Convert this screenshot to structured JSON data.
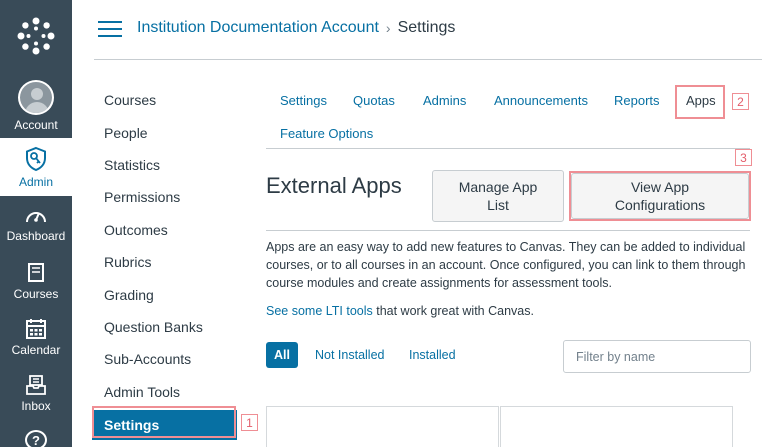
{
  "global_nav": {
    "account": "Account",
    "admin": "Admin",
    "dashboard": "Dashboard",
    "courses": "Courses",
    "calendar": "Calendar",
    "inbox": "Inbox",
    "help_glyph": "?"
  },
  "breadcrumb": {
    "account": "Institution Documentation Account",
    "separator": "›",
    "current": "Settings"
  },
  "sidebar": {
    "items": [
      {
        "label": "Courses"
      },
      {
        "label": "People"
      },
      {
        "label": "Statistics"
      },
      {
        "label": "Permissions"
      },
      {
        "label": "Outcomes"
      },
      {
        "label": "Rubrics"
      },
      {
        "label": "Grading"
      },
      {
        "label": "Question Banks"
      },
      {
        "label": "Sub-Accounts"
      },
      {
        "label": "Admin Tools"
      },
      {
        "label": "Settings"
      }
    ]
  },
  "tabs": {
    "settings": "Settings",
    "quotas": "Quotas",
    "admins": "Admins",
    "announcements": "Announcements",
    "reports": "Reports",
    "apps": "Apps",
    "feature_options": "Feature Options"
  },
  "badges": {
    "one": "1",
    "two": "2",
    "three": "3"
  },
  "apps": {
    "heading": "External Apps",
    "manage_label": "Manage App List",
    "view_label": "View App Configurations",
    "description": "Apps are an easy way to add new features to Canvas. They can be added to individual courses, or to all courses in an account. Once configured, you can link to them through course modules and create assignments for assessment tools.",
    "lti_link": "See some LTI tools",
    "lti_rest": " that work great with Canvas.",
    "filters": {
      "all": "All",
      "not_installed": "Not Installed",
      "installed": "Installed"
    },
    "filter_placeholder": "Filter by name"
  },
  "colors": {
    "accent": "#0770a3",
    "nav_bg": "#394b58",
    "highlight": "#ef8e94"
  },
  "icons": [
    "canvas-logo-icon",
    "hamburger-icon",
    "admin-shield-icon",
    "dashboard-gauge-icon",
    "courses-book-icon",
    "calendar-icon",
    "inbox-tray-icon",
    "help-icon"
  ]
}
